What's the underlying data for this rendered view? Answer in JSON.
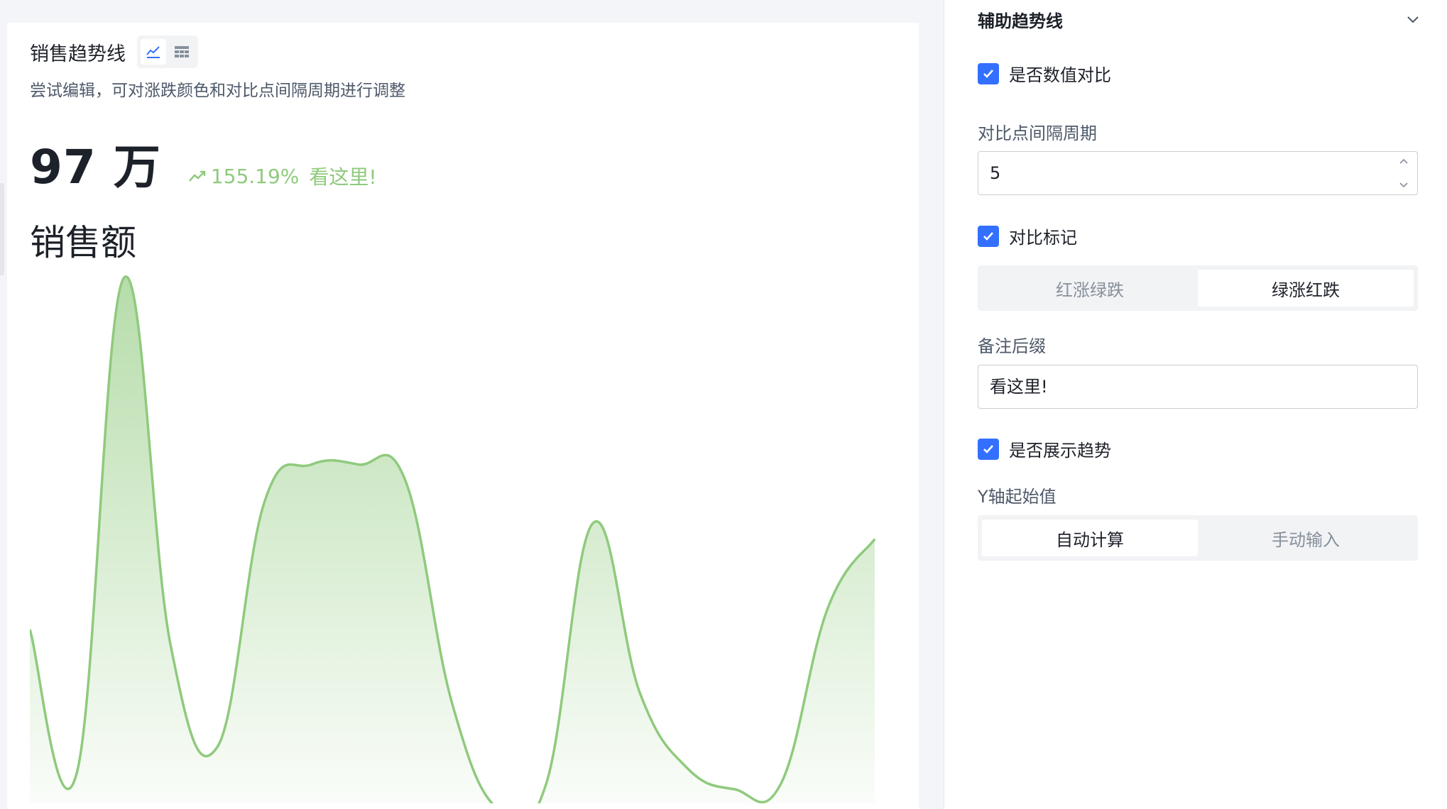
{
  "card": {
    "title": "销售趋势线",
    "description": "尝试编辑，可对涨跌颜色和对比点间隔周期进行调整",
    "view_icons": [
      "line-chart-icon",
      "table-icon"
    ],
    "kpi_value": "97 万",
    "kpi_change": "155.19%",
    "kpi_suffix": "看这里!",
    "kpi_label": "销售额",
    "trend_color": "#8fca7d"
  },
  "chart_data": {
    "type": "area",
    "x": [
      0,
      1,
      2,
      3,
      4,
      5,
      6,
      7,
      8,
      9,
      10,
      11,
      12,
      13,
      14,
      15,
      16,
      17,
      18
    ],
    "values": [
      34,
      7,
      100,
      31,
      12,
      58,
      65,
      65,
      62,
      20,
      0,
      5,
      54,
      22,
      8,
      4,
      5,
      38,
      51
    ],
    "title": "",
    "xlabel": "",
    "ylabel": "",
    "grid": false,
    "legend": "none",
    "color": "#8fca7d"
  },
  "panel": {
    "title": "辅助趋势线",
    "compare_value_label": "是否数值对比",
    "interval_label": "对比点间隔周期",
    "interval_value": "5",
    "compare_marker_label": "对比标记",
    "marker_options": [
      "红涨绿跌",
      "绿涨红跌"
    ],
    "marker_selected": "绿涨红跌",
    "suffix_label": "备注后缀",
    "suffix_value": "看这里!",
    "show_trend_label": "是否展示趋势",
    "y_start_label": "Y轴起始值",
    "y_start_options": [
      "自动计算",
      "手动输入"
    ],
    "y_start_selected": "自动计算",
    "accent": "#3370ff"
  }
}
